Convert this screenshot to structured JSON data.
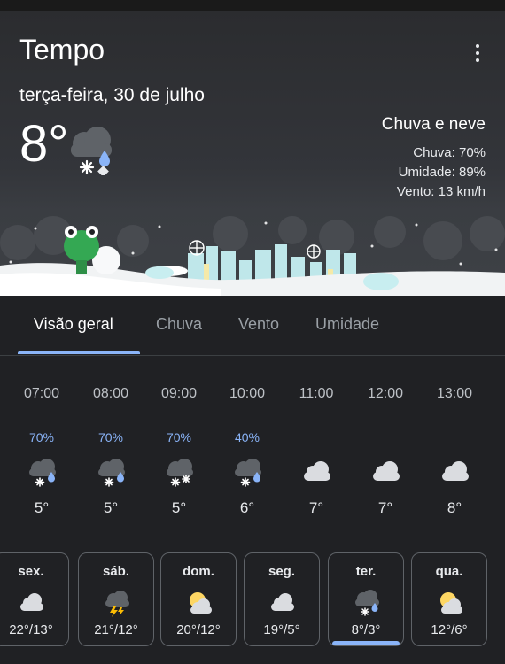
{
  "app": {
    "title": "Tempo"
  },
  "current": {
    "date": "terça-feira, 30 de julho",
    "temperature": "8°",
    "condition": "Chuva e neve",
    "rain": "Chuva: 70%",
    "humidity": "Umidade: 89%",
    "wind": "Vento: 13 km/h",
    "icon": "rain-snow-icon"
  },
  "tabs": [
    {
      "label": "Visão geral",
      "active": true
    },
    {
      "label": "Chuva",
      "active": false
    },
    {
      "label": "Vento",
      "active": false
    },
    {
      "label": "Umidade",
      "active": false
    }
  ],
  "hourly": [
    {
      "time": "07:00",
      "precip": "70%",
      "temp": "5°",
      "icon": "rain-snow-icon"
    },
    {
      "time": "08:00",
      "precip": "70%",
      "temp": "5°",
      "icon": "rain-snow-icon"
    },
    {
      "time": "09:00",
      "precip": "70%",
      "temp": "5°",
      "icon": "snow-icon"
    },
    {
      "time": "10:00",
      "precip": "40%",
      "temp": "6°",
      "icon": "rain-snow-icon"
    },
    {
      "time": "11:00",
      "precip": "",
      "temp": "7°",
      "icon": "cloud-icon"
    },
    {
      "time": "12:00",
      "precip": "",
      "temp": "7°",
      "icon": "cloud-icon"
    },
    {
      "time": "13:00",
      "precip": "",
      "temp": "8°",
      "icon": "cloud-icon"
    }
  ],
  "daily": [
    {
      "day": "sex.",
      "temps": "22°/13°",
      "icon": "cloud-icon",
      "selected": false
    },
    {
      "day": "sáb.",
      "temps": "21°/12°",
      "icon": "thunderstorm-icon",
      "selected": false
    },
    {
      "day": "dom.",
      "temps": "20°/12°",
      "icon": "partly-sunny-icon",
      "selected": false
    },
    {
      "day": "seg.",
      "temps": "19°/5°",
      "icon": "cloud-icon",
      "selected": false
    },
    {
      "day": "ter.",
      "temps": "8°/3°",
      "icon": "rain-snow-icon",
      "selected": true
    },
    {
      "day": "qua.",
      "temps": "12°/6°",
      "icon": "partly-sunny-icon",
      "selected": false
    }
  ],
  "colors": {
    "accent": "#8ab4f8",
    "background": "#202124",
    "card_border": "#5f6368"
  }
}
